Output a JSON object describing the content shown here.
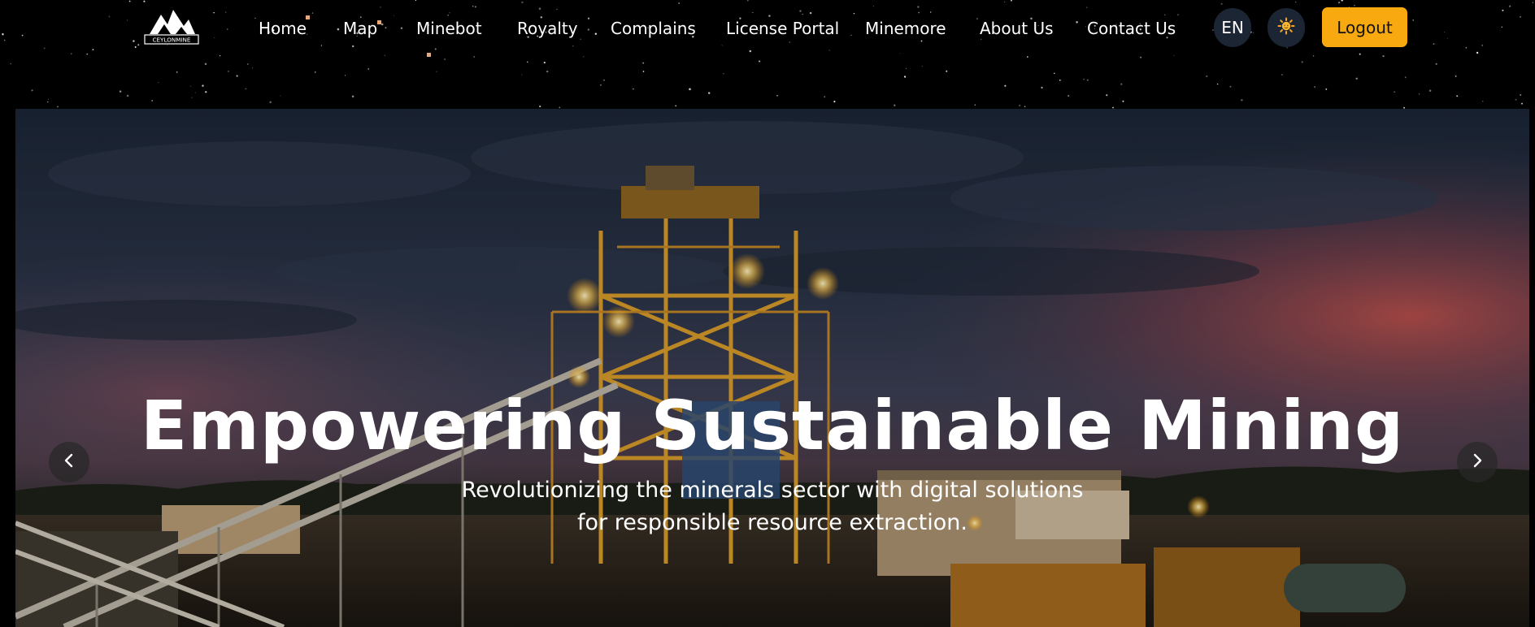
{
  "brand": {
    "logo_text": "CEYLONMINE"
  },
  "nav": {
    "items": [
      {
        "label": "Home"
      },
      {
        "label": "Map"
      },
      {
        "label": "Minebot"
      },
      {
        "label": "Royalty"
      },
      {
        "label": "Complains"
      },
      {
        "label": "License Portal"
      },
      {
        "label": "Minemore"
      },
      {
        "label": "About Us"
      },
      {
        "label": "Contact Us"
      }
    ],
    "language_label": "EN",
    "theme_icon": "sun-icon",
    "logout_label": "Logout"
  },
  "hero": {
    "title": "Empowering Sustainable Mining",
    "subtitle": "Revolutionizing the minerals sector with digital solutions for responsible resource extraction.",
    "prev_icon": "chevron-left-icon",
    "next_icon": "chevron-right-icon"
  },
  "colors": {
    "accent": "#f8a90f",
    "pill_bg": "#1c2533",
    "background": "#000000"
  }
}
